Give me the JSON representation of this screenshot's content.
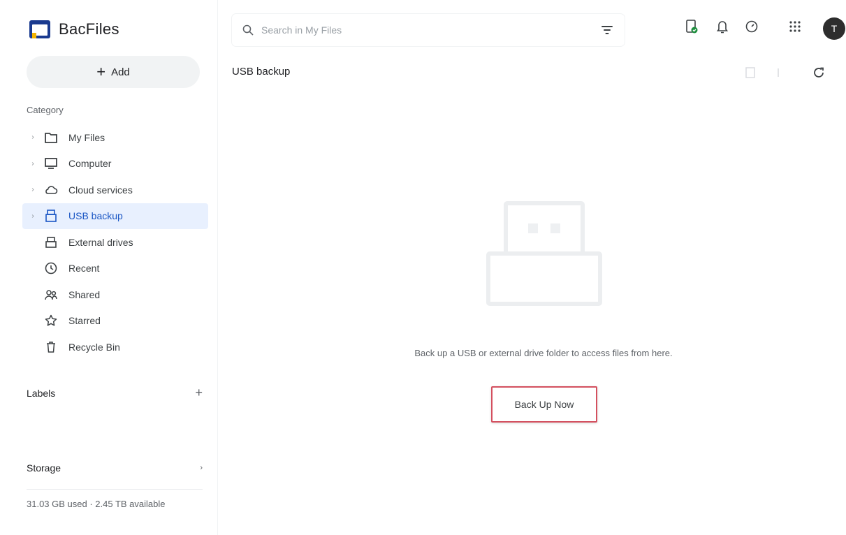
{
  "app": {
    "name": "BacFiles"
  },
  "sidebar": {
    "add_label": "Add",
    "category_label": "Category",
    "items": [
      {
        "label": "My Files",
        "icon": "folder-icon",
        "has_caret": true,
        "active": false
      },
      {
        "label": "Computer",
        "icon": "computer-icon",
        "has_caret": true,
        "active": false
      },
      {
        "label": "Cloud services",
        "icon": "cloud-icon",
        "has_caret": true,
        "active": false
      },
      {
        "label": "USB backup",
        "icon": "usb-drive-icon",
        "has_caret": true,
        "active": true
      },
      {
        "label": "External drives",
        "icon": "external-drive-icon",
        "has_caret": false,
        "active": false
      },
      {
        "label": "Recent",
        "icon": "clock-icon",
        "has_caret": false,
        "active": false
      },
      {
        "label": "Shared",
        "icon": "people-icon",
        "has_caret": false,
        "active": false
      },
      {
        "label": "Starred",
        "icon": "star-icon",
        "has_caret": false,
        "active": false
      },
      {
        "label": "Recycle Bin",
        "icon": "trash-icon",
        "has_caret": false,
        "active": false
      }
    ],
    "labels_title": "Labels",
    "storage_title": "Storage",
    "storage_text": "31.03 GB used · 2.45 TB available"
  },
  "header": {
    "search_placeholder": "Search in My Files",
    "avatar_initial": "T"
  },
  "main": {
    "title": "USB backup",
    "empty_message": "Back up a USB or external drive folder to access files from here.",
    "backup_button": "Back Up Now"
  },
  "colors": {
    "accent": "#1a56c4",
    "active_bg": "#e8f0fe",
    "button_border": "#d4505f"
  }
}
